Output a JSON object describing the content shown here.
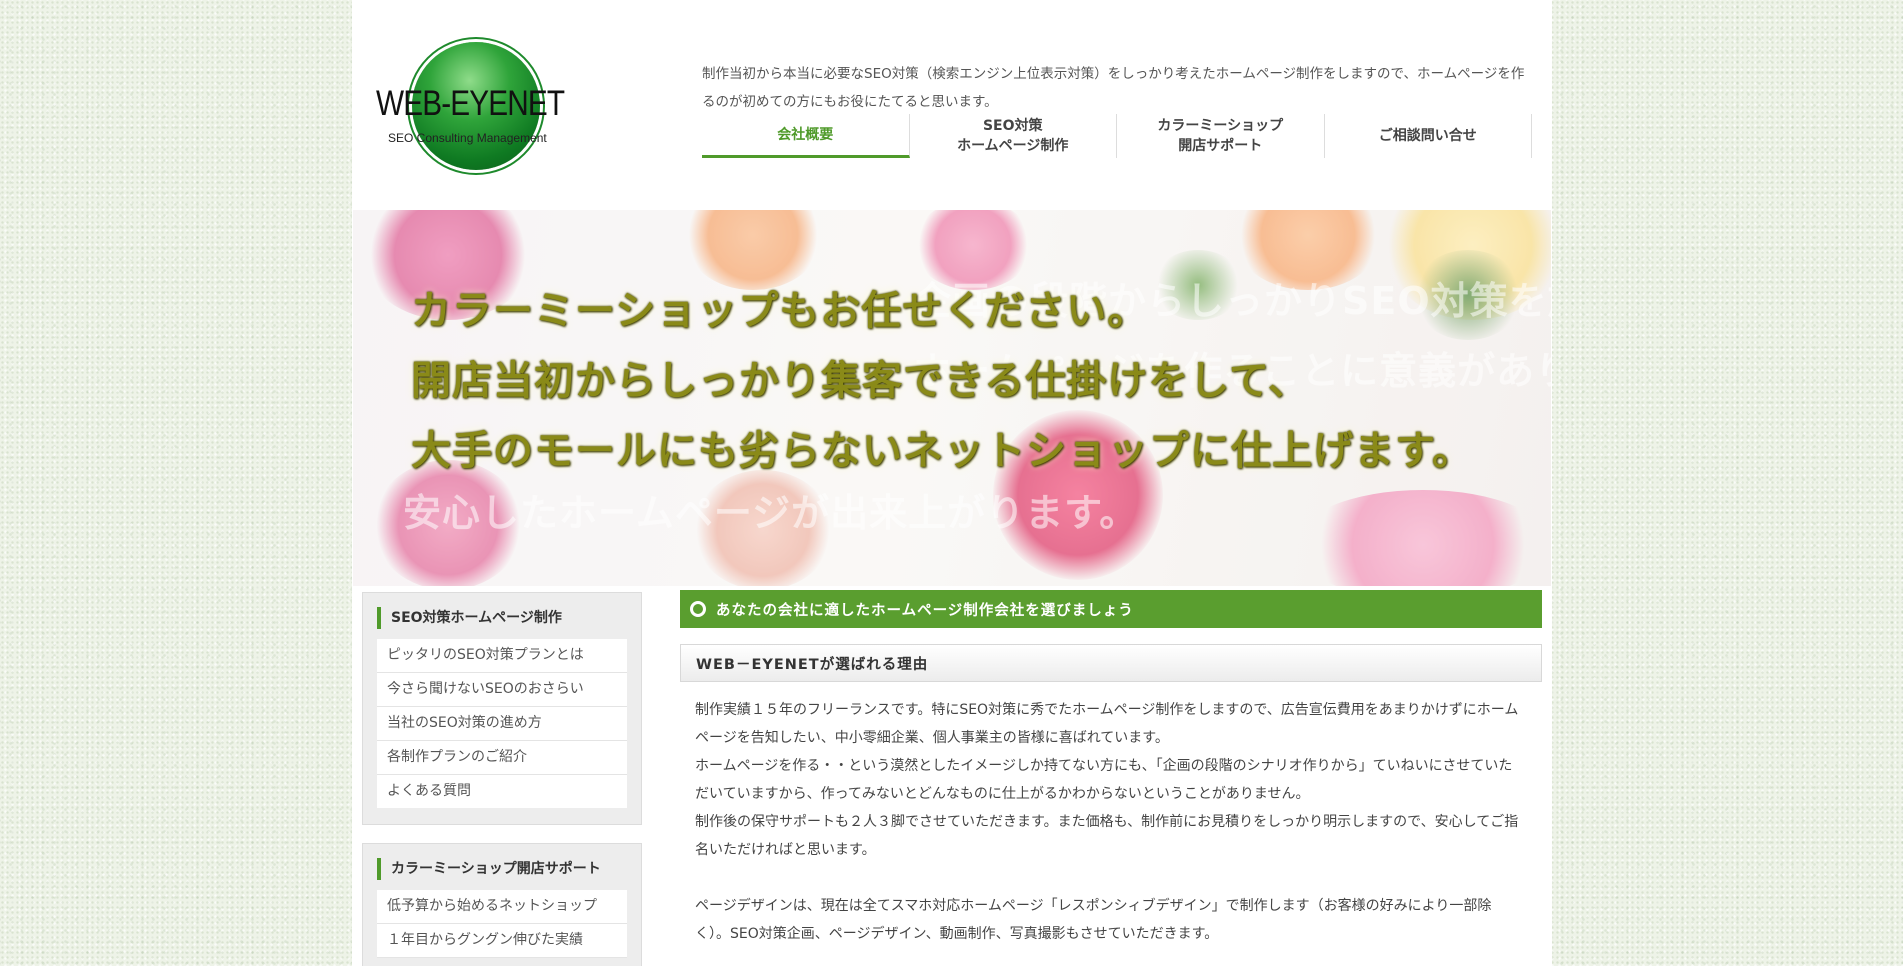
{
  "header": {
    "logo_name": "WEB-EYENET",
    "logo_sub": "SEO Consulting Management",
    "intro": "制作当初から本当に必要なSEO対策（検索エンジン上位表示対策）をしっかり考えたホームページ制作をしますので、ホームページを作るのが初めての方にもお役にたてると思います。"
  },
  "nav": [
    {
      "line1": "会社概要",
      "line2": ""
    },
    {
      "line1": "SEO対策",
      "line2": "ホームページ制作"
    },
    {
      "line1": "カラーミーショップ",
      "line2": "開店サポート"
    },
    {
      "line1": "ご相談問い合せ",
      "line2": ""
    }
  ],
  "hero": {
    "lines": [
      "カラーミーショップもお任せください。",
      "開店当初からしっかり集客できる仕掛けをして、",
      "大手のモールにも劣らないネットショップに仕上げます。"
    ],
    "ghost_lines": [
      "企画の段階からしっかりSEO対策を施した",
      "ホームページを作ることに意義があります。",
      "安心したホームページが出来上がります。"
    ]
  },
  "sidebar": {
    "box1": {
      "title": "SEO対策ホームページ制作",
      "items": [
        "ピッタリのSEO対策プランとは",
        "今さら聞けないSEOのおさらい",
        "当社のSEO対策の進め方",
        "各制作プランのご紹介",
        "よくある質問"
      ]
    },
    "box2": {
      "title": "カラーミーショップ開店サポート",
      "items": [
        "低予算から始めるネットショップ",
        "１年目からグングン伸びた実績"
      ]
    }
  },
  "main": {
    "bar_title": "あなたの会社に適したホームページ制作会社を選びましょう",
    "sub_title": "WEB－EYENETが選ばれる理由",
    "paragraphs": [
      "制作実績１５年のフリーランスです。特にSEO対策に秀でたホームページ制作をしますので、広告宣伝費用をあまりかけずにホームページを告知したい、中小零細企業、個人事業主の皆様に喜ばれています。",
      "ホームページを作る・・という漠然としたイメージしか持てない方にも、「企画の段階のシナリオ作りから」ていねいにさせていただいていますから、作ってみないとどんなものに仕上がるかわからないということがありません。",
      "制作後の保守サポートも２人３脚でさせていただきます。また価格も、制作前にお見積りをしっかり明示しますので、安心してご指名いただければと思います。",
      "ページデザインは、現在は全てスマホ対応ホームページ「レスポンシィブデザイン」で制作します（お客様の好みにより一部除く）。SEO対策企画、ページデザイン、動画制作、写真撮影もさせていただきます。"
    ]
  }
}
